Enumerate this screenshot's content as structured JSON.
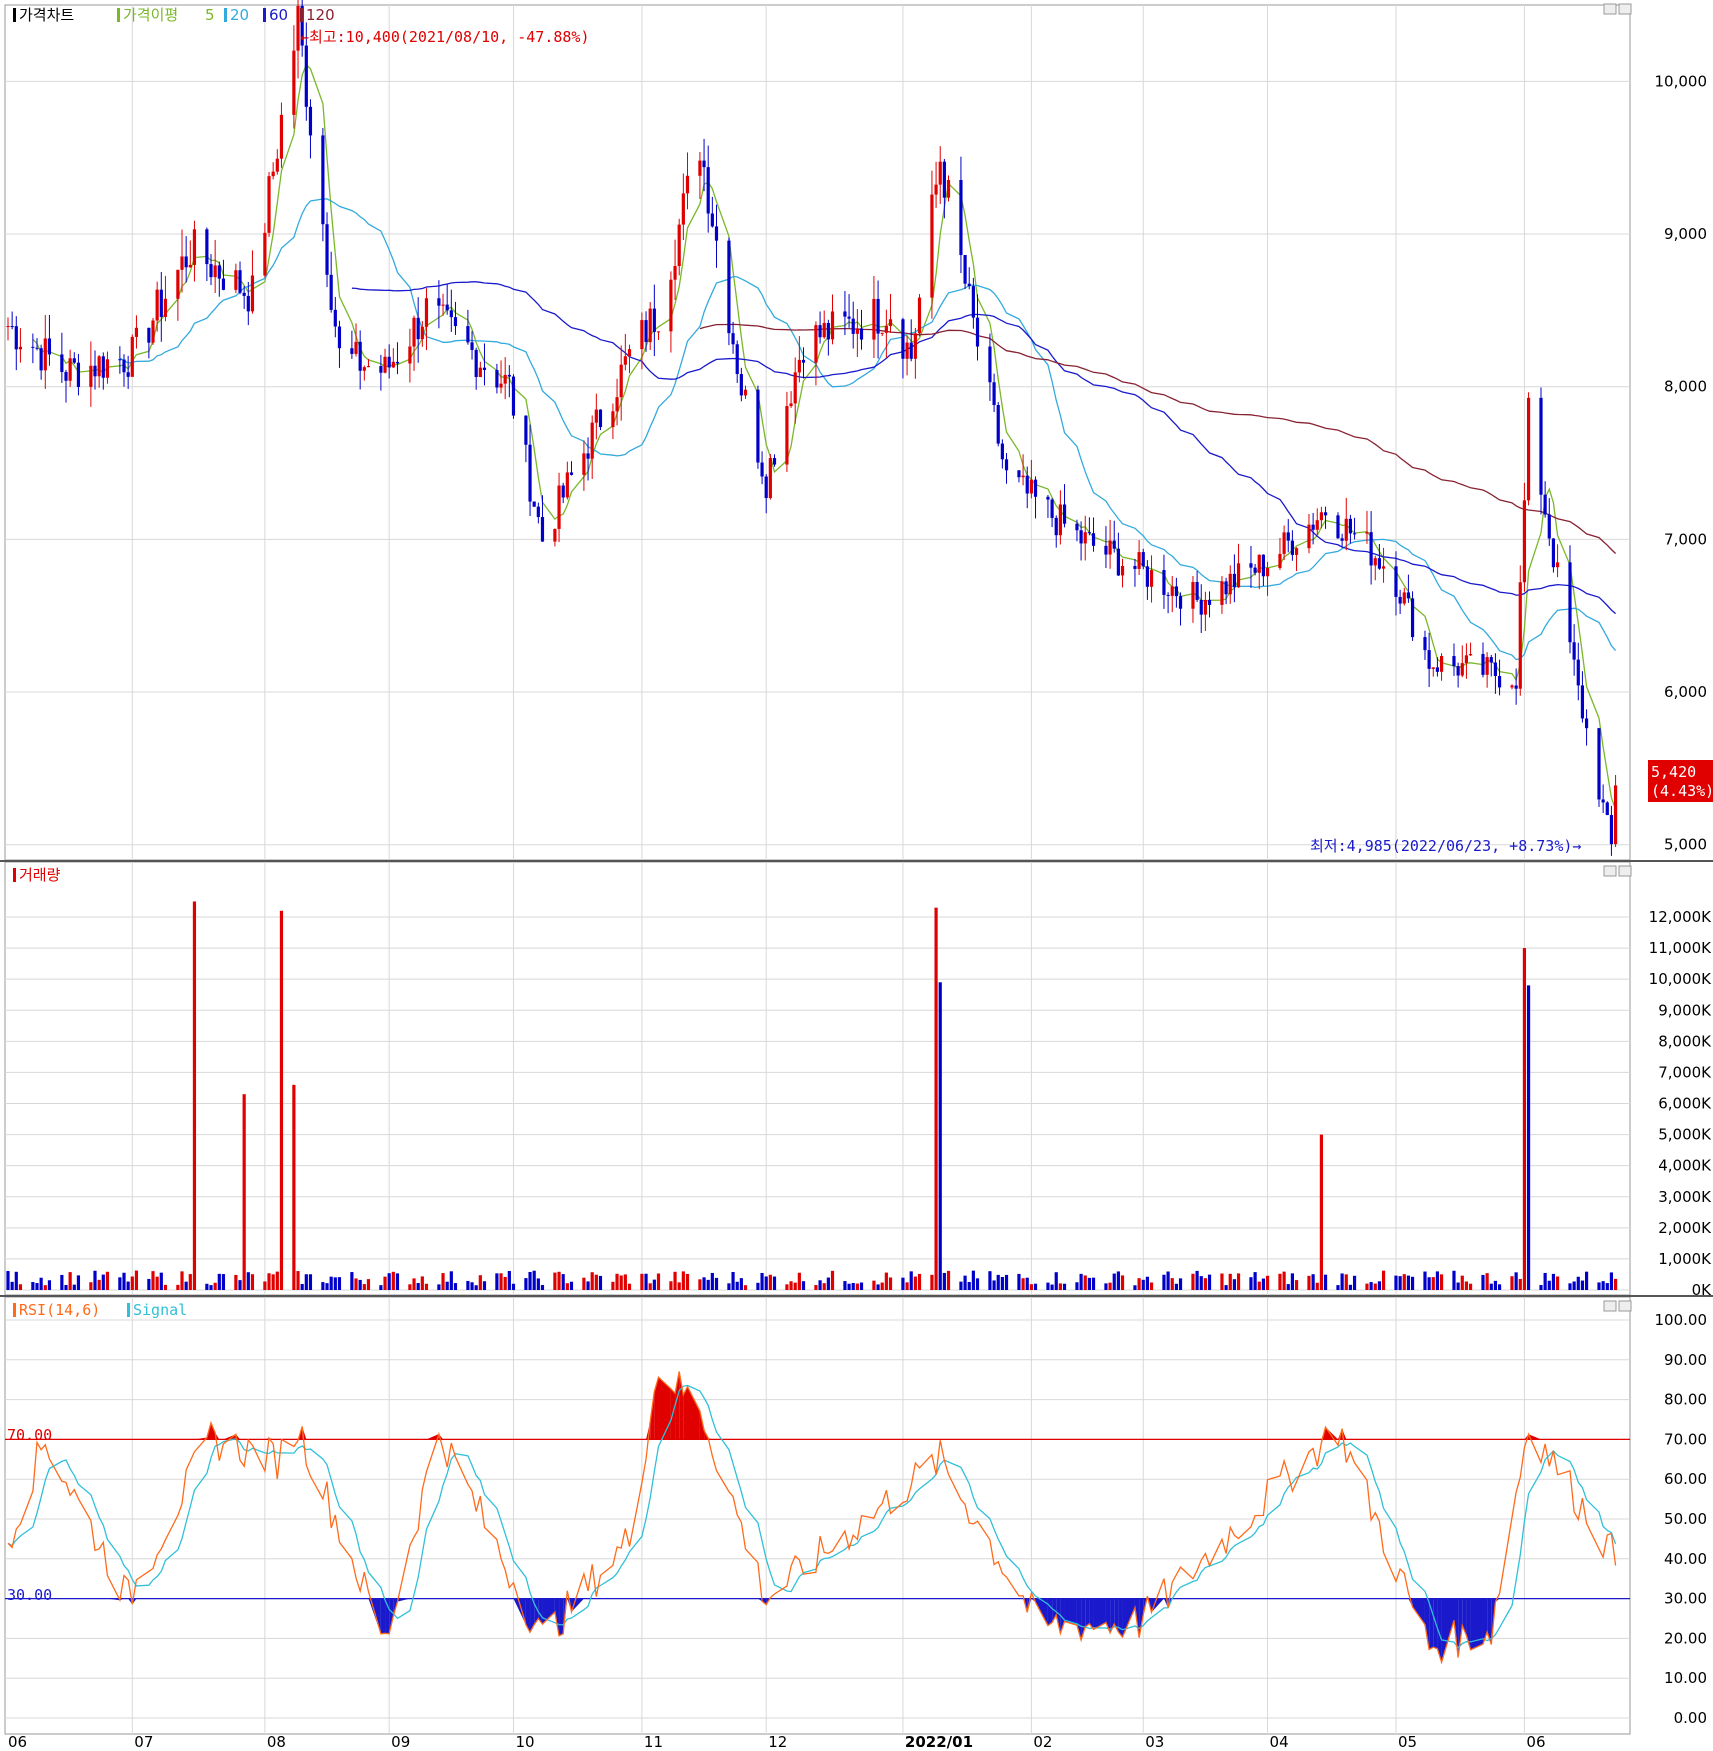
{
  "colors": {
    "up": "#e00000",
    "down": "#0000c8",
    "ma5": "#7ab82a",
    "ma20": "#33aadd",
    "ma60": "#1a1acc",
    "ma120": "#882233",
    "rsi": "#ff6a1a",
    "signal": "#30c0d8",
    "rsi_upper": "#e00000",
    "rsi_lower": "#1a1acc",
    "grid": "#d8d8d8"
  },
  "panels": {
    "price": {
      "legend": [
        "가격차트",
        "가격이평",
        "5",
        "20",
        "60",
        "120"
      ],
      "max_annotation": "←최고:10,400(2021/08/10, -47.88%)",
      "min_annotation": "최저:4,985(2022/06/23, +8.73%)→",
      "last_price": "5,420",
      "last_change": "(4.43%)",
      "yticks": [
        "10,000",
        "9,000",
        "8,000",
        "7,000",
        "6,000",
        "5,000"
      ]
    },
    "volume": {
      "legend": "거래량",
      "yticks": [
        "12,000K",
        "11,000K",
        "10,000K",
        "9,000K",
        "8,000K",
        "7,000K",
        "6,000K",
        "5,000K",
        "4,000K",
        "3,000K",
        "2,000K",
        "1,000K",
        "0K"
      ]
    },
    "rsi": {
      "legend": [
        "RSI(14,6)",
        "Signal"
      ],
      "upper_label": "70.00",
      "lower_label": "30.00",
      "yticks": [
        "100.00",
        "90.00",
        "80.00",
        "70.00",
        "60.00",
        "50.00",
        "40.00",
        "30.00",
        "20.00",
        "10.00",
        "0.00"
      ]
    }
  },
  "x_axis": {
    "labels": [
      "06",
      "07",
      "08",
      "09",
      "10",
      "11",
      "12",
      "2022/01",
      "02",
      "03",
      "04",
      "05",
      "06"
    ]
  },
  "chart_data": [
    {
      "type": "candlestick",
      "title": "가격차트",
      "ylim": [
        4900,
        10500
      ],
      "x_range": [
        "2021-06",
        "2022-06"
      ],
      "ohlc_keypoints": [
        {
          "x": "2021-06-01",
          "close": 8400
        },
        {
          "x": "2021-06-15",
          "close": 8100
        },
        {
          "x": "2021-07-01",
          "close": 8200
        },
        {
          "x": "2021-07-15",
          "close": 8900
        },
        {
          "x": "2021-07-30",
          "close": 8600
        },
        {
          "x": "2021-08-10",
          "close": 10400
        },
        {
          "x": "2021-08-20",
          "close": 8200
        },
        {
          "x": "2021-08-31",
          "close": 8100
        },
        {
          "x": "2021-09-10",
          "close": 8500
        },
        {
          "x": "2021-09-30",
          "close": 8000
        },
        {
          "x": "2021-10-08",
          "close": 7000
        },
        {
          "x": "2021-10-29",
          "close": 8200
        },
        {
          "x": "2021-11-05",
          "close": 8500
        },
        {
          "x": "2021-11-15",
          "close": 9600
        },
        {
          "x": "2021-11-25",
          "close": 8000
        },
        {
          "x": "2021-12-01",
          "close": 7400
        },
        {
          "x": "2021-12-10",
          "close": 8300
        },
        {
          "x": "2021-12-31",
          "close": 8500
        },
        {
          "x": "2022-01-05",
          "close": 8200
        },
        {
          "x": "2022-01-12",
          "close": 9500
        },
        {
          "x": "2022-01-20",
          "close": 8400
        },
        {
          "x": "2022-01-28",
          "close": 7400
        },
        {
          "x": "2022-02-15",
          "close": 7000
        },
        {
          "x": "2022-03-15",
          "close": 6600
        },
        {
          "x": "2022-04-01",
          "close": 6850
        },
        {
          "x": "2022-04-15",
          "close": 7200
        },
        {
          "x": "2022-05-01",
          "close": 6800
        },
        {
          "x": "2022-05-10",
          "close": 6200
        },
        {
          "x": "2022-05-31",
          "close": 6100
        },
        {
          "x": "2022-06-03",
          "close": 7800
        },
        {
          "x": "2022-06-15",
          "close": 6000
        },
        {
          "x": "2022-06-23",
          "close": 4985
        },
        {
          "x": "2022-06-24",
          "close": 5420
        }
      ],
      "moving_averages": [
        {
          "name": "5",
          "end": 5350
        },
        {
          "name": "20",
          "end": 6150
        },
        {
          "name": "60",
          "end": 6550
        },
        {
          "name": "120",
          "end": 7050
        }
      ],
      "max": {
        "value": 10400,
        "date": "2021/08/10",
        "pct": "-47.88%"
      },
      "min": {
        "value": 4985,
        "date": "2022/06/23",
        "pct": "+8.73%"
      }
    },
    {
      "type": "bar",
      "title": "거래량",
      "ylim": [
        0,
        12500
      ],
      "unit": "K",
      "spikes": [
        {
          "x": "2021-07-16",
          "value": 12500,
          "dir": "up"
        },
        {
          "x": "2021-07-28",
          "value": 6300,
          "dir": "up"
        },
        {
          "x": "2021-08-06",
          "value": 12200,
          "dir": "up"
        },
        {
          "x": "2021-08-09",
          "value": 6600,
          "dir": "up"
        },
        {
          "x": "2022-01-11",
          "value": 12300,
          "dir": "up"
        },
        {
          "x": "2022-01-12",
          "value": 9900,
          "dir": "down"
        },
        {
          "x": "2022-04-14",
          "value": 5000,
          "dir": "up"
        },
        {
          "x": "2022-06-02",
          "value": 11000,
          "dir": "up"
        },
        {
          "x": "2022-06-03",
          "value": 9800,
          "dir": "down"
        }
      ],
      "baseline_typical": 300
    },
    {
      "type": "line",
      "title": "RSI(14,6)",
      "ylim": [
        0,
        100
      ],
      "series_names": [
        "RSI(14,6)",
        "Signal"
      ],
      "bands": [
        30,
        70
      ],
      "rsi_keypoints": [
        {
          "x": "2021-06",
          "v": 45
        },
        {
          "x": "2021-06-10",
          "v": 70
        },
        {
          "x": "2021-06-30",
          "v": 30
        },
        {
          "x": "2021-07-10",
          "v": 50
        },
        {
          "x": "2021-07-20",
          "v": 70
        },
        {
          "x": "2021-08-05",
          "v": 65
        },
        {
          "x": "2021-08-10",
          "v": 73
        },
        {
          "x": "2021-08-25",
          "v": 35
        },
        {
          "x": "2021-08-31",
          "v": 19
        },
        {
          "x": "2021-09-13",
          "v": 72
        },
        {
          "x": "2021-10-08",
          "v": 20
        },
        {
          "x": "2021-10-29",
          "v": 45
        },
        {
          "x": "2021-11-05",
          "v": 88
        },
        {
          "x": "2021-11-15",
          "v": 78
        },
        {
          "x": "2021-12-01",
          "v": 30
        },
        {
          "x": "2022-01-12",
          "v": 65
        },
        {
          "x": "2022-02-05",
          "v": 23
        },
        {
          "x": "2022-03-01",
          "v": 24
        },
        {
          "x": "2022-04-18",
          "v": 73
        },
        {
          "x": "2022-05-10",
          "v": 18
        },
        {
          "x": "2022-05-25",
          "v": 22
        },
        {
          "x": "2022-06-03",
          "v": 74
        },
        {
          "x": "2022-06-24",
          "v": 40
        }
      ]
    }
  ]
}
